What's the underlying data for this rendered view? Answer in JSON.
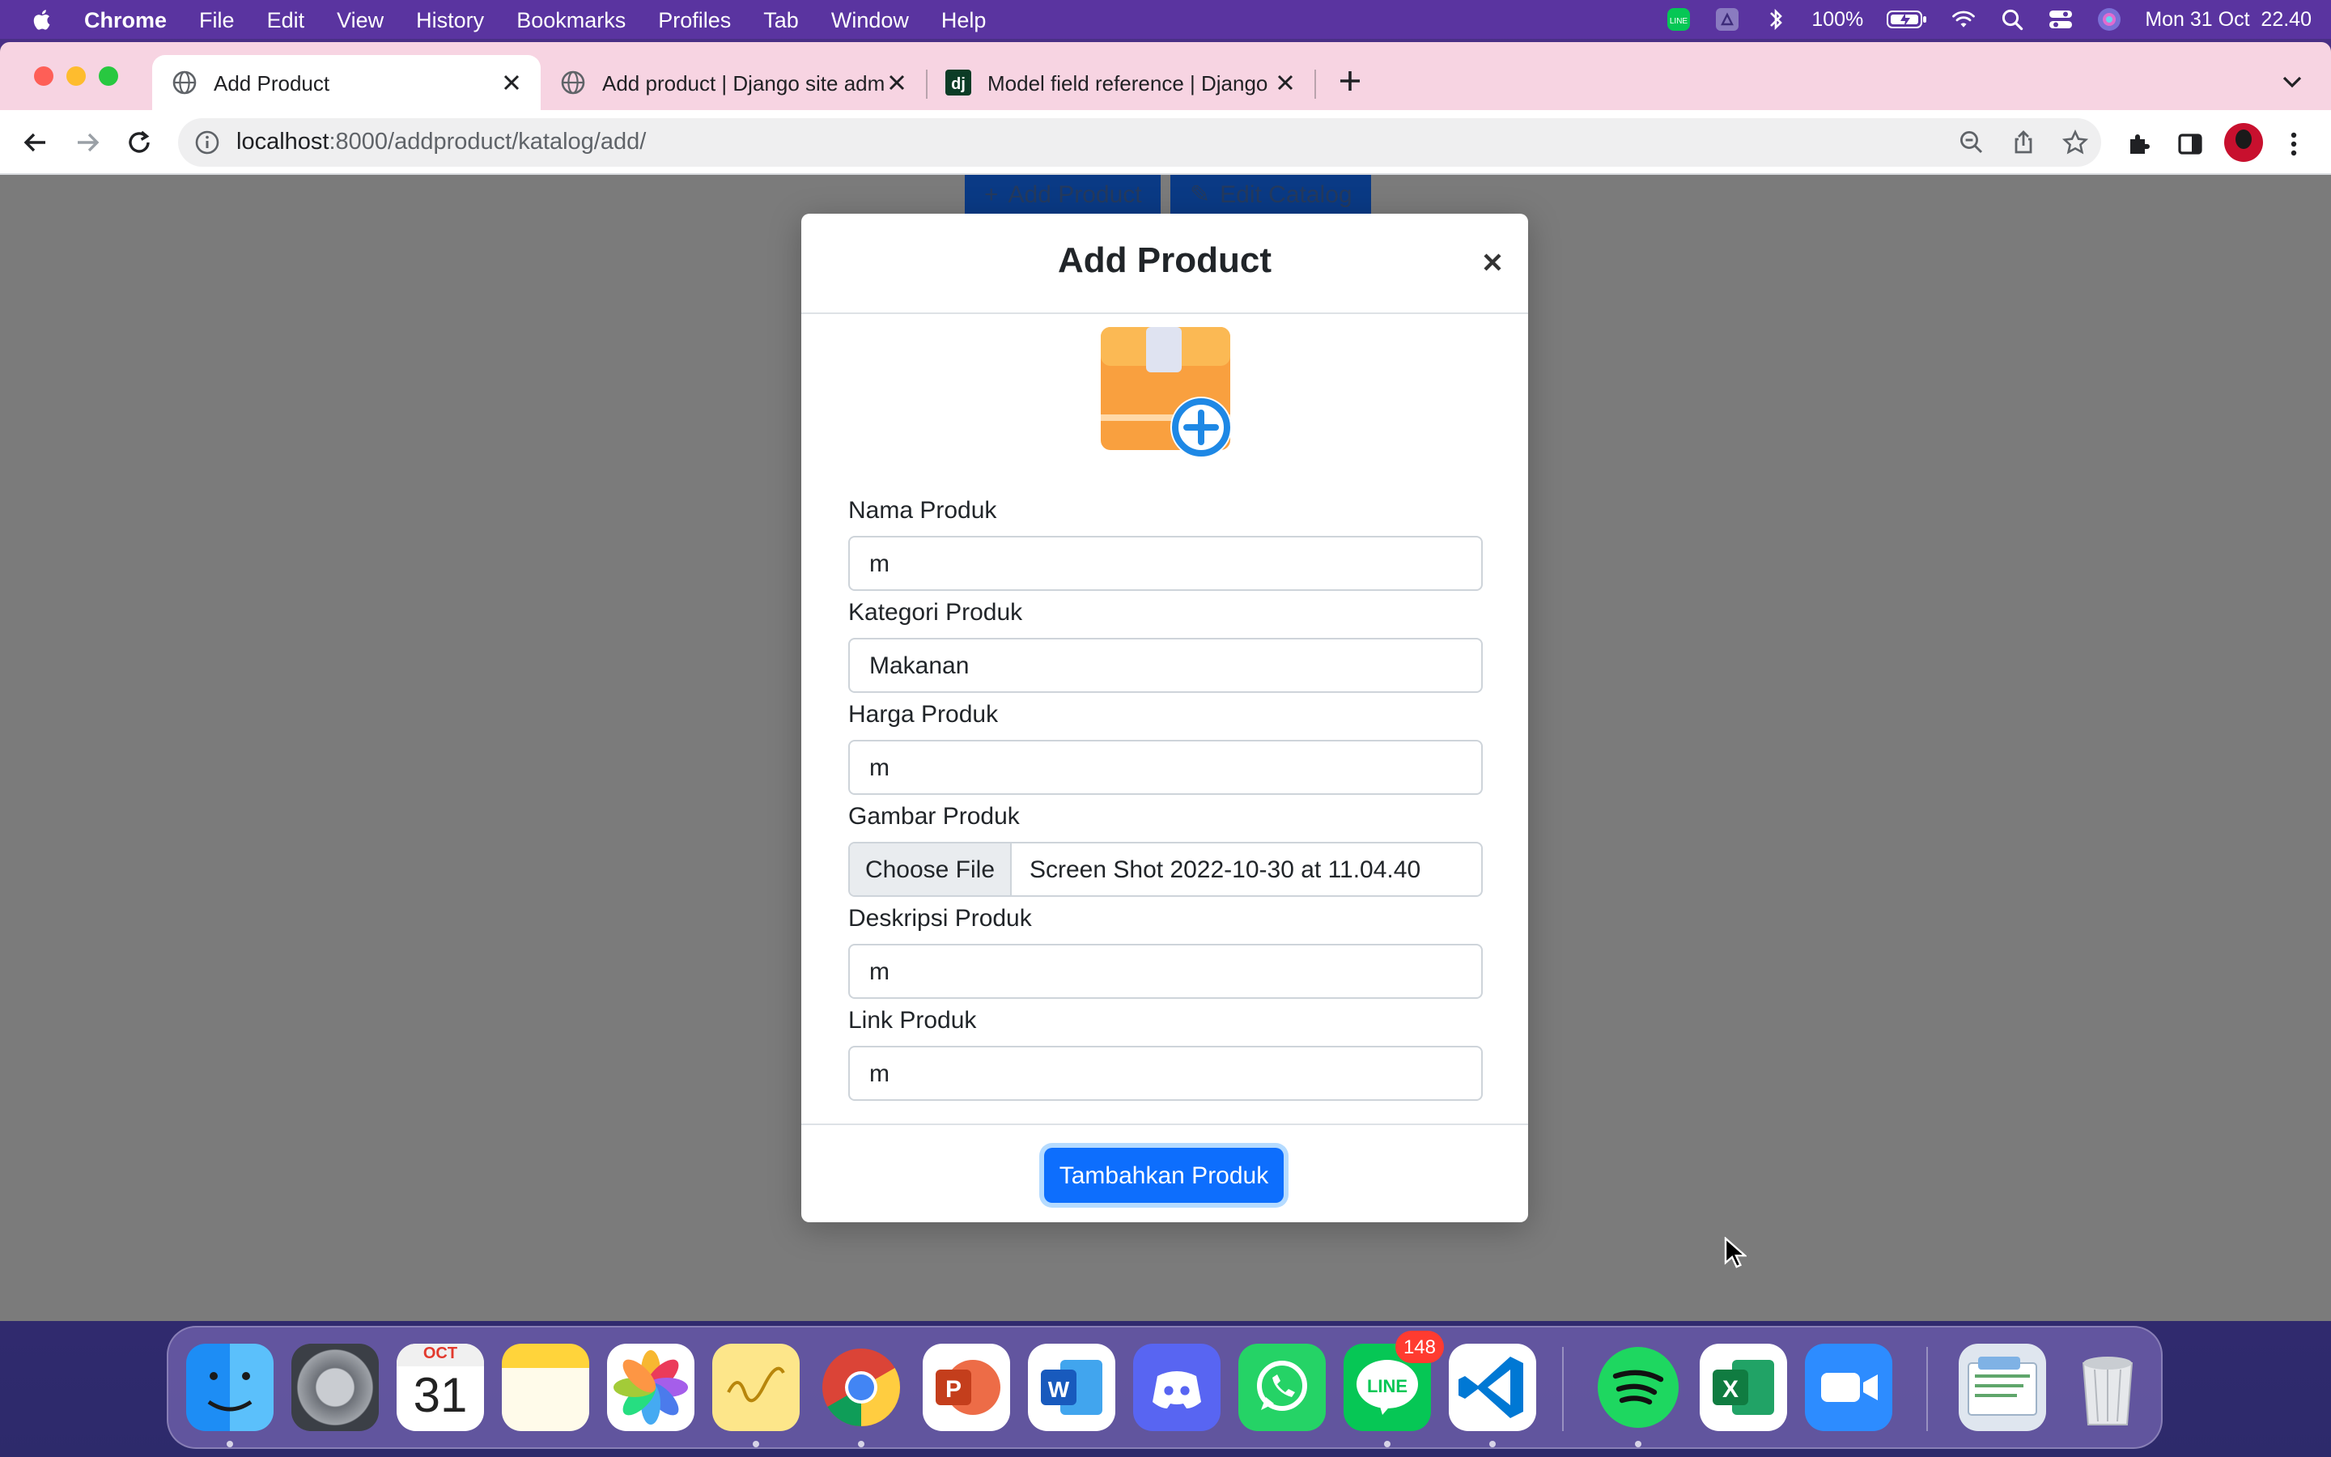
{
  "menubar": {
    "app": "Chrome",
    "items": [
      "File",
      "Edit",
      "View",
      "History",
      "Bookmarks",
      "Profiles",
      "Tab",
      "Window",
      "Help"
    ],
    "battery": "100%",
    "clock": "Mon 31 Oct  22.40"
  },
  "browser": {
    "tabs": [
      {
        "title": "Add Product"
      },
      {
        "title": "Add product | Django site admi"
      },
      {
        "title": "Model field reference | Django"
      }
    ],
    "url_host": "localhost",
    "url_path": ":8000/addproduct/katalog/add/"
  },
  "page": {
    "add_button": "Add Product",
    "edit_button": "Edit Catalog"
  },
  "modal": {
    "title": "Add Product",
    "fields": [
      {
        "label": "Nama Produk",
        "value": "m"
      },
      {
        "label": "Kategori Produk",
        "value": "Makanan"
      },
      {
        "label": "Harga Produk",
        "value": "m"
      },
      {
        "label": "Gambar Produk",
        "button": "Choose File",
        "value": "Screen Shot 2022-10-30 at 11.04.40"
      },
      {
        "label": "Deskripsi Produk",
        "value": "m"
      },
      {
        "label": "Link Produk",
        "value": "m"
      }
    ],
    "submit": "Tambahkan Produk"
  },
  "dock": {
    "calendar_month": "OCT",
    "calendar_day": "31",
    "line_badge": "148"
  }
}
